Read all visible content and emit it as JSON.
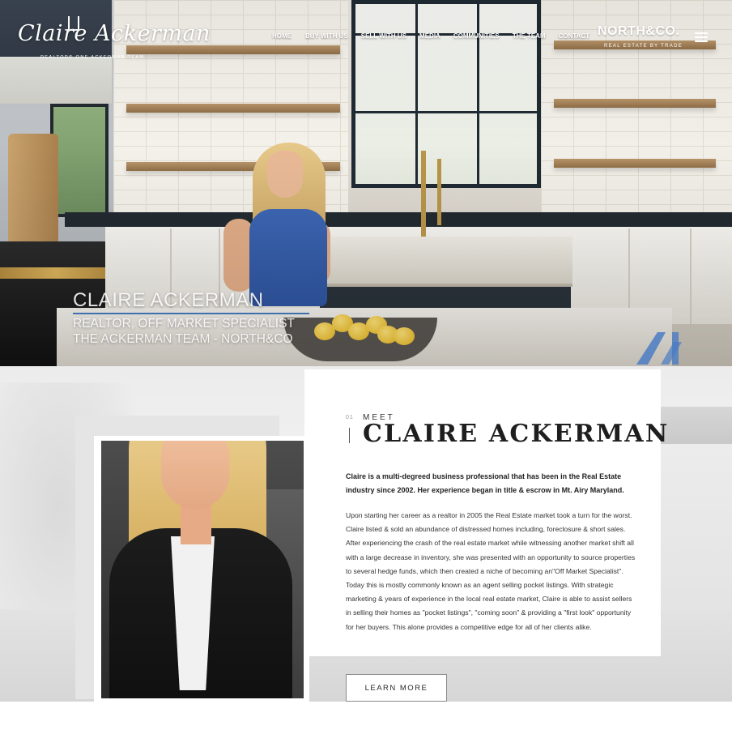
{
  "header": {
    "logo_script": "Claire Ackerman",
    "logo_sub": "REALTOR® ONE ACKERMAN TEAM",
    "nav": [
      "HOME",
      "BUY WITH US",
      "SELL WITH US",
      "MEDIA",
      "COMMUNITIES",
      "THE TEAM",
      "CONTACT"
    ],
    "brand_name": "NORTH&CO.",
    "brand_tag": "REAL ESTATE BY TRADE",
    "menu_icon": "hamburger-menu-icon"
  },
  "hero": {
    "title": "CLAIRE ACKERMAN",
    "line1": "REALTOR, OFF MARKET SPECIALIST",
    "line2": "THE ACKERMAN TEAM - NORTH&CO",
    "accent_color": "#3f6fb0"
  },
  "about": {
    "number": "01",
    "label": "MEET",
    "heading": "CLAIRE ACKERMAN",
    "lead": "Claire is a multi-degreed business professional that has been in the Real Estate industry since 2002. Her experience began in title & escrow in Mt. Airy Maryland.",
    "body": "Upon starting her career as a realtor in 2005 the Real Estate market took a turn for the worst. Claire listed & sold an abundance of distressed homes including, foreclosure & short sales. After experiencing the crash of the real estate market while witnessing another market shift all with a large decrease in inventory, she was presented with an opportunity to source properties to several hedge funds, which then created a niche of becoming an\"Off Market Specialist\". Today this is mostly commonly known as an agent selling pocket listings. With strategic marketing & years of experience in the local real estate market, Claire is able to assist sellers in selling their homes as \"pocket listings\", \"coming soon\" & providing a \"first look\" opportunity for her buyers. This alone provides a competitive edge for all of her clients alike.",
    "button": "LEARN MORE"
  }
}
